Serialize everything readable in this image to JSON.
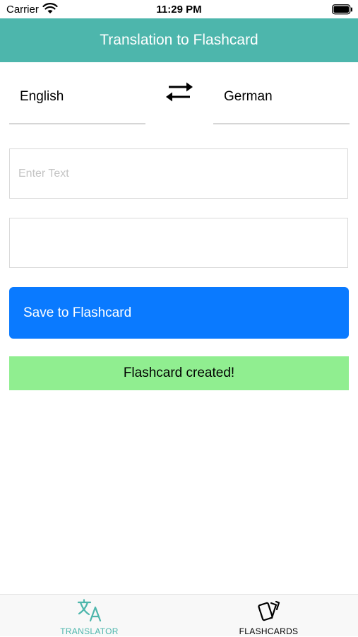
{
  "status_bar": {
    "carrier": "Carrier",
    "time": "11:29 PM"
  },
  "header": {
    "title": "Translation to Flashcard",
    "color": "#4db6ac"
  },
  "languages": {
    "source": "English",
    "target": "German",
    "swap_icon": "swap-arrows-icon"
  },
  "source_input": {
    "placeholder": "Enter Text",
    "value": ""
  },
  "translation_output": {
    "value": ""
  },
  "save_button": {
    "label": "Save to Flashcard",
    "color": "#0a7aff"
  },
  "status_message": {
    "text": "Flashcard created!",
    "color": "#90ee90"
  },
  "tab_bar": {
    "active_color": "#4db6ac",
    "tabs": [
      {
        "label": "TRANSLATOR",
        "icon": "translate-icon",
        "active": true
      },
      {
        "label": "FLASHCARDS",
        "icon": "flashcards-icon",
        "active": false
      }
    ]
  }
}
